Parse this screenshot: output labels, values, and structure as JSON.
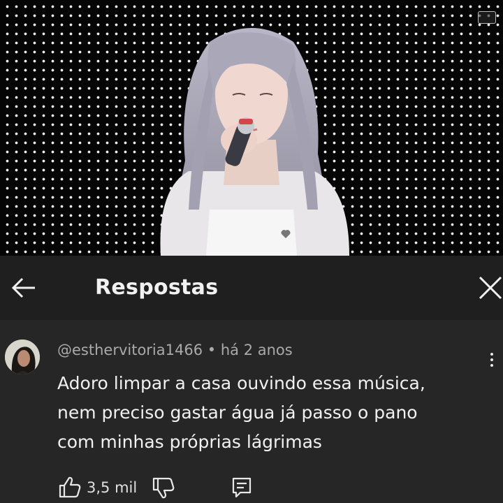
{
  "header": {
    "title": "Respostas",
    "back_icon": "arrow-left-icon",
    "close_icon": "close-icon"
  },
  "comment": {
    "username": "@esthervitoria1466",
    "separator": "•",
    "time": "há 2 anos",
    "text_lines": [
      "Adoro limpar a casa ouvindo essa música,",
      "nem preciso gastar água já passo o pano",
      "com minhas próprias lágrimas"
    ],
    "likes": "3,5 mil"
  },
  "colors": {
    "header_bg": "#1f1f1f",
    "content_bg": "#262626",
    "text_primary": "#f1f1f1",
    "text_secondary": "#aaaaaa"
  }
}
